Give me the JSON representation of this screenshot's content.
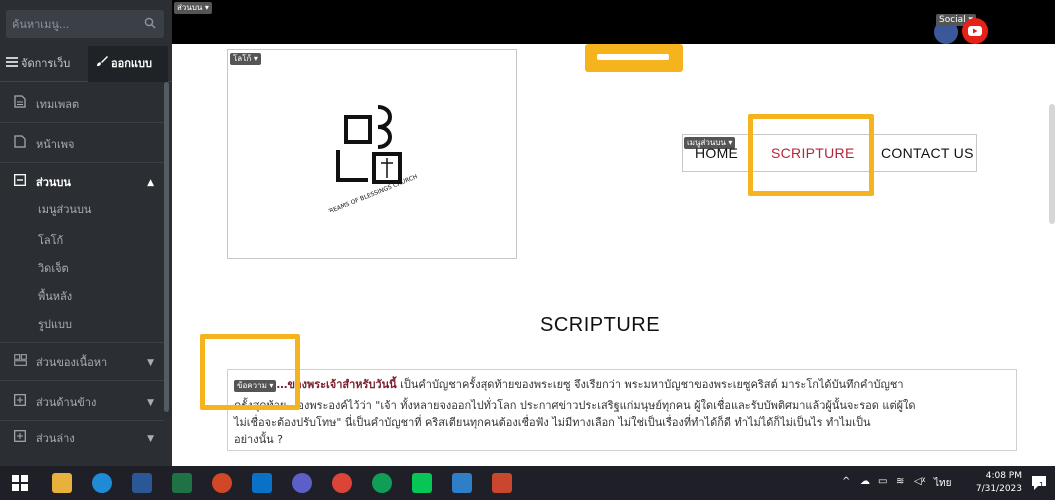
{
  "sidebar": {
    "search_placeholder": "ค้นหาเมนู...",
    "tab_manage": "จัดการเว็บ",
    "tab_design": "ออกแบบ",
    "items": [
      {
        "label": "เทมเพลต"
      },
      {
        "label": "หน้าเพจ"
      },
      {
        "label": "ส่วนบน"
      },
      {
        "label": "ส่วนของเนื้อหา"
      },
      {
        "label": "ส่วนด้านข้าง"
      },
      {
        "label": "ส่วนล่าง"
      }
    ],
    "sub_items": [
      {
        "label": "เมนูส่วนบน"
      },
      {
        "label": "โลโก้"
      },
      {
        "label": "วิดเจ็ต"
      },
      {
        "label": "พื้นหลัง"
      },
      {
        "label": "รูปแบบ"
      }
    ]
  },
  "topbar": {
    "section_tag": "ส่วนบน ▾",
    "social_tag": "Social ▾"
  },
  "page": {
    "logo_tag": "โลโก้ ▾",
    "logo_text": "STREAMS OF BLESSINGS CHURCH",
    "menu_tag": "เมนูส่วนบน ▾",
    "menu": [
      {
        "label": "HOME"
      },
      {
        "label": "SCRIPTURE"
      },
      {
        "label": "CONTACT US"
      }
    ],
    "title": "SCRIPTURE",
    "text_tag": "ข้อความ ▾",
    "text_bold": "…ของพระเจ้าสำหรับวันนี้",
    "text_line1": " เป็นคำบัญชาครั้งสุดท้ายของพระเยซู จึงเรียกว่า พระมหาบัญชาของพระเยซูคริสต์  มาระโกได้บันทึกคำบัญชา",
    "text_line2": "ครั้งสุดท้าย…องพระองค์ไว้ว่า \"เจ้า ทั้งหลายจงออกไปทั่วโลก ประกาศข่าวประเสริฐแก่มนุษย์ทุกคน ผู้ใดเชื่อและรับบัพติศมาแล้วผู้นั้นจะรอด แต่ผู้ใด",
    "text_line3": "ไม่เชื่อจะต้องปรับโทษ\"   นี่เป็นคำบัญชาที่ คริสเตียนทุกคนต้องเชื่อฟัง  ไม่มีทางเลือก  ไม่ใช่เป็นเรื่องที่ทำได้ก็ดี  ทำไม่ได้ก็ไม่เป็นไร  ทำไมเป็น",
    "text_line4": "อย่างนั้น ?"
  },
  "taskbar": {
    "language": "ไทย",
    "time": "4:08 PM",
    "date": "7/31/2023",
    "notification_count": "1"
  },
  "colors": {
    "highlight": "#f5b41e",
    "active_menu": "#b3263a",
    "sidebar_bg": "#2b2f34"
  }
}
